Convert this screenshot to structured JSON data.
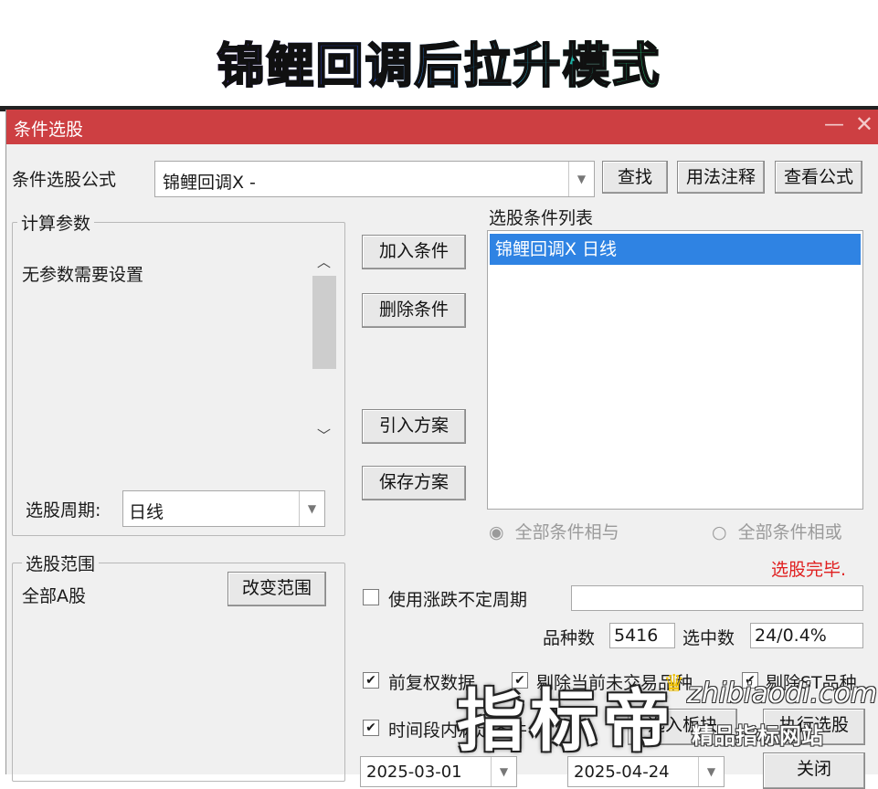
{
  "banner": {
    "title": "锦鲤回调后拉升模式"
  },
  "window": {
    "title": "条件选股",
    "minimize": "—",
    "close": "✕"
  },
  "formula": {
    "label": "条件选股公式",
    "value": "锦鲤回调X  -",
    "find_button": "查找",
    "usage_button": "用法注释",
    "view_button": "查看公式"
  },
  "params": {
    "group_label": "计算参数",
    "message": "无参数需要设置",
    "period_label": "选股周期:",
    "period_value": "日线"
  },
  "scope": {
    "group_label": "选股范围",
    "value": "全部A股",
    "change_button": "改变范围"
  },
  "actions": {
    "add_condition": "加入条件",
    "delete_condition": "删除条件",
    "import_plan": "引入方案",
    "save_plan": "保存方案"
  },
  "condition_list": {
    "label": "选股条件列表",
    "items": [
      "锦鲤回调X  日线"
    ]
  },
  "logic": {
    "and_label": "全部条件相与",
    "or_label": "全部条件相或"
  },
  "status": {
    "text": "选股完毕.",
    "color": "#e02020"
  },
  "options": {
    "unfixed_period_label": "使用涨跌不定周期",
    "variety_label": "品种数",
    "variety_value": "5416",
    "selected_label": "选中数",
    "selected_value": "24/0.4%",
    "prior_rights_label": "前复权数据",
    "exclude_untraded_label": "剔除当前未交易品种",
    "exclude_st_label": "剔除ST品种",
    "time_range_label": "时间段内满足条件",
    "start_date": "2025-03-01",
    "end_date": "2025-04-24",
    "add_to_block_button": "选入板块",
    "run_button": "执行选股",
    "close_button": "关闭"
  },
  "watermark": {
    "big": "指标帝",
    "domain": "zhibiaodi.com",
    "slogan": "精品指标网站"
  },
  "colors": {
    "titlebar": "#cd3f42",
    "selection": "#2f83e3",
    "status": "#e02020"
  },
  "icons": [
    "dropdown-arrow-icon",
    "scroll-up-icon",
    "scroll-down-icon",
    "checkmark-icon",
    "radio-icon",
    "crown-icon"
  ]
}
